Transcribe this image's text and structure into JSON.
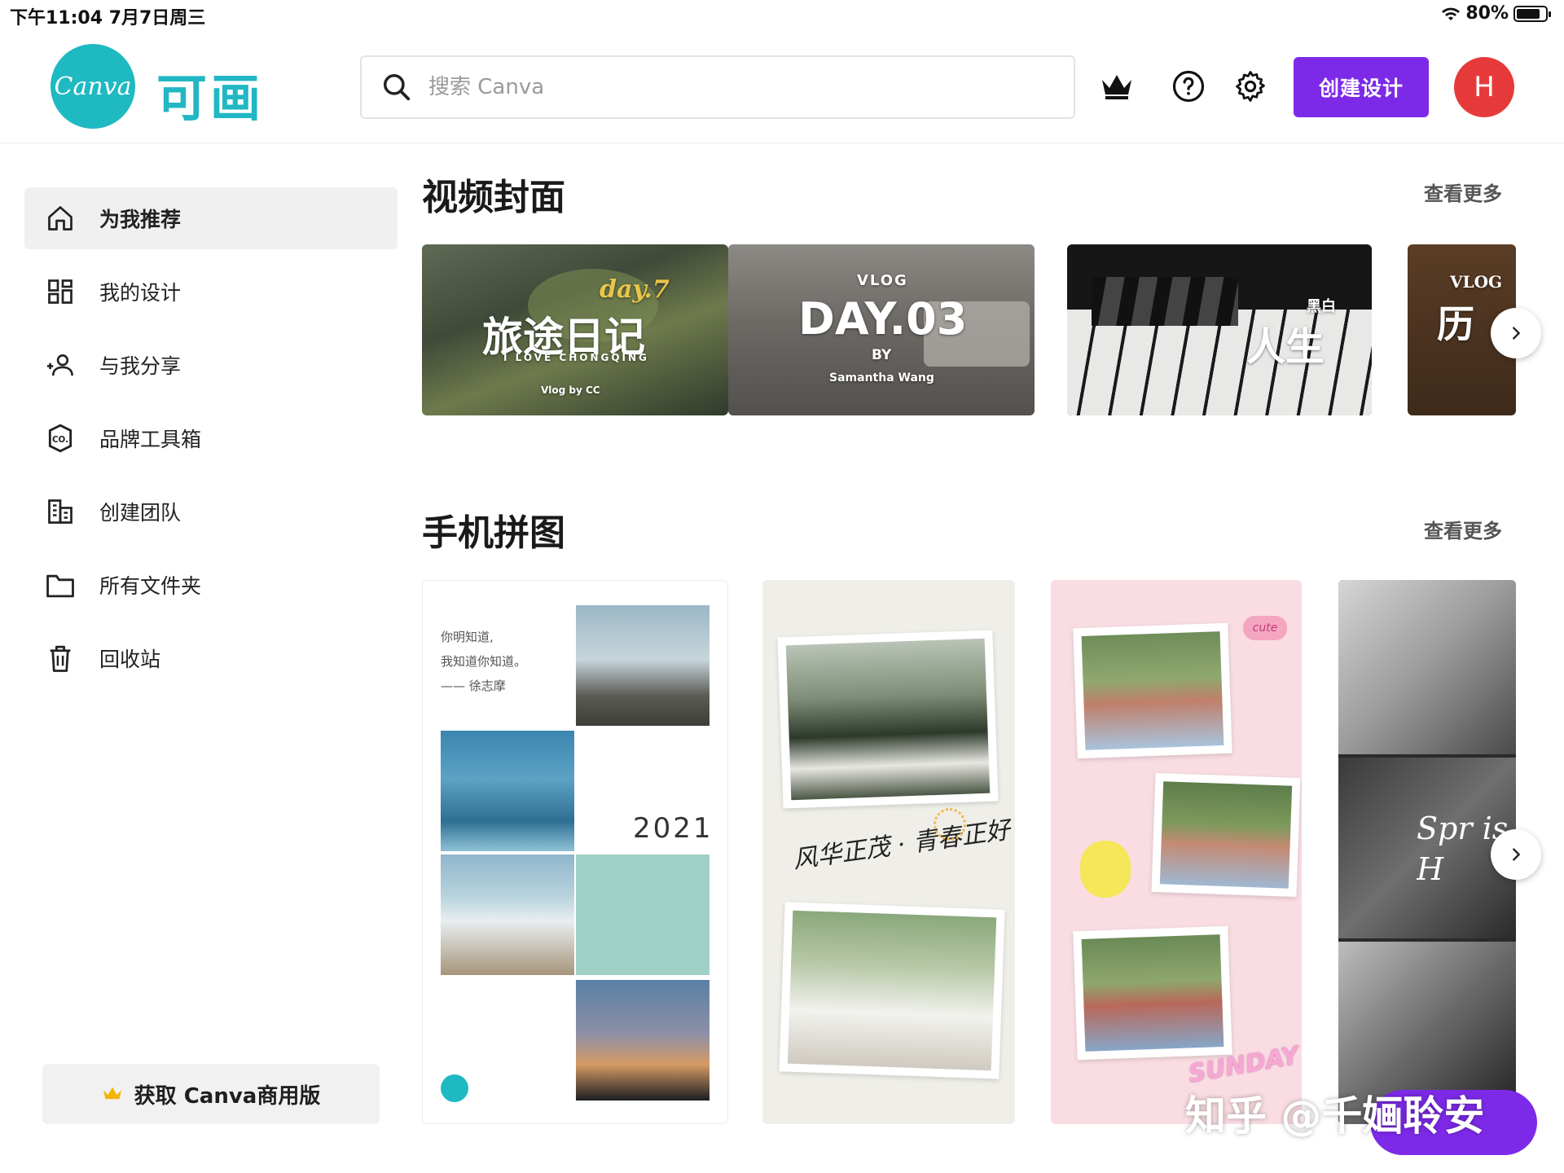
{
  "status_bar": {
    "time": "下午11:04   7月7日周三",
    "battery": "80%"
  },
  "header": {
    "logo_text": "Canva",
    "logo_cn": "可画",
    "search_placeholder": "搜索 Canva",
    "create_button": "创建设计",
    "avatar_initial": "H"
  },
  "sidebar": {
    "items": [
      {
        "label": "为我推荐",
        "icon": "home-icon"
      },
      {
        "label": "我的设计",
        "icon": "grid-icon"
      },
      {
        "label": "与我分享",
        "icon": "people-icon"
      },
      {
        "label": "品牌工具箱",
        "icon": "brand-icon"
      },
      {
        "label": "创建团队",
        "icon": "building-icon"
      },
      {
        "label": "所有文件夹",
        "icon": "folder-icon"
      },
      {
        "label": "回收站",
        "icon": "trash-icon"
      }
    ],
    "pro_button": "获取 Canva商用版"
  },
  "sections": {
    "video_covers": {
      "title": "视频封面",
      "see_more": "查看更多",
      "cards": [
        {
          "line1": "day.7",
          "line2": "旅途日记",
          "line3": "I LOVE CHONGQING",
          "line4": "Vlog by CC"
        },
        {
          "line1": "VLOG",
          "line2": "DAY.03",
          "line3": "BY",
          "line4": "Samantha Wang"
        },
        {
          "line1": "人生",
          "line2": "黑白"
        },
        {
          "line1": "VLOG",
          "line2": "历"
        }
      ]
    },
    "phone_collage": {
      "title": "手机拼图",
      "see_more": "查看更多",
      "card1": {
        "poem": [
          "你明知道,",
          "我知道你知道。",
          "—— 徐志摩"
        ],
        "year": "2021"
      },
      "card2": {
        "handwriting": "风华正茂 · 青春正好"
      },
      "card3": {
        "badge": "cute",
        "footer": "SUNDAY"
      },
      "card4": {
        "script": "Spr is H"
      }
    }
  },
  "watermark": "知乎 @千婳聆安",
  "colors": {
    "brand_teal": "#1fb9c2",
    "primary_purple": "#7d2ae8",
    "avatar_red": "#e63a3a"
  }
}
